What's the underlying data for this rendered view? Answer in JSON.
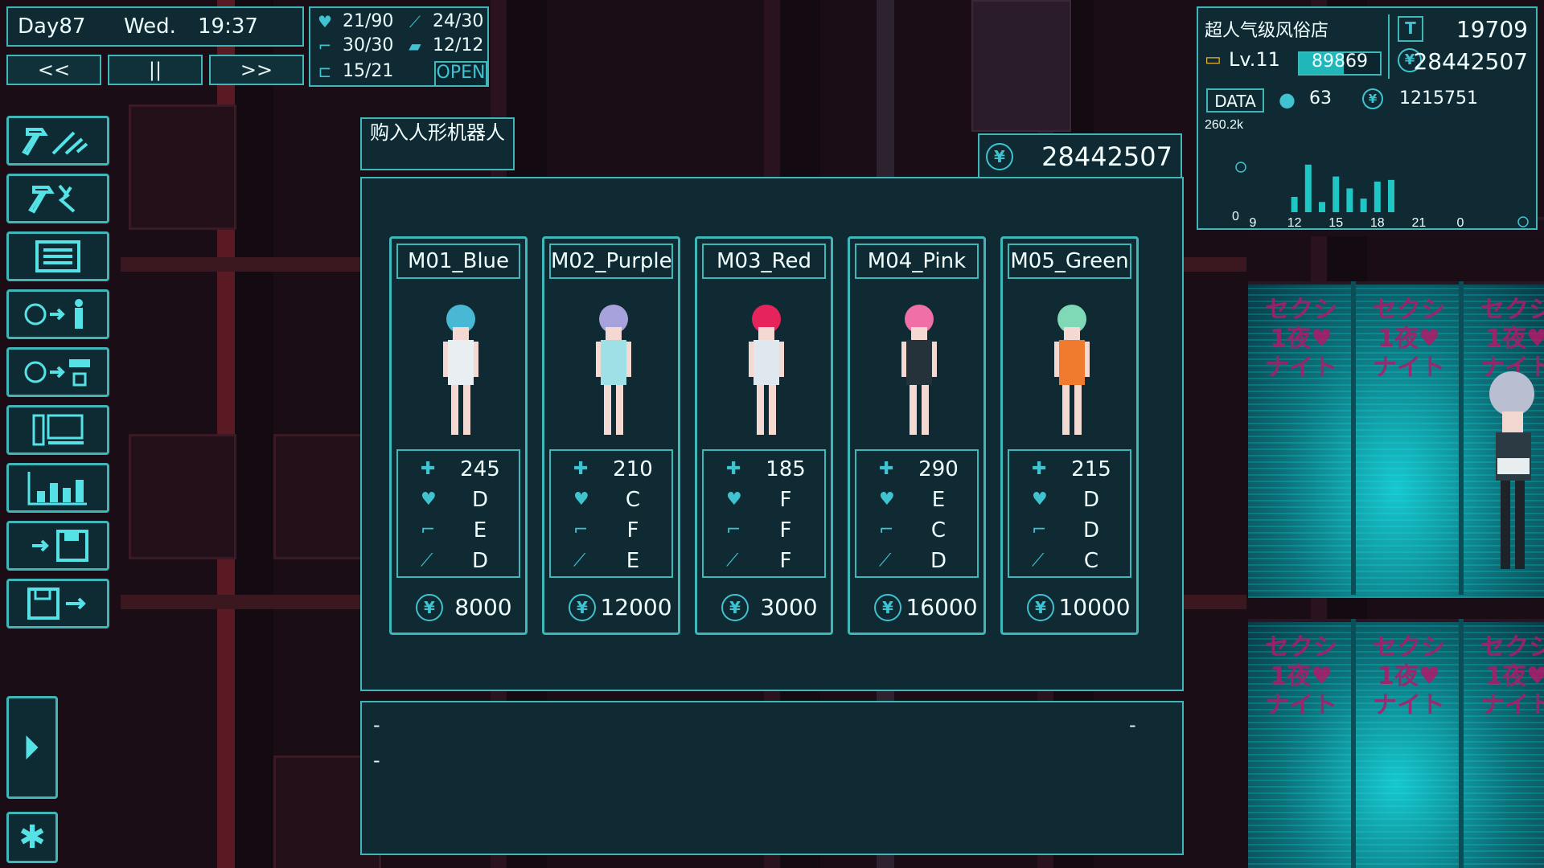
{
  "hud": {
    "day": "Day87",
    "weekday": "Wed.",
    "time": "19:37",
    "speed_buttons": [
      "<<",
      "||",
      ">>"
    ],
    "stats": [
      {
        "icon": "heart-icon",
        "value": "21/90"
      },
      {
        "icon": "wrench-icon",
        "value": "24/30"
      },
      {
        "icon": "gun-icon",
        "value": "30/30"
      },
      {
        "icon": "box-icon",
        "value": "12/12"
      },
      {
        "icon": "bed-icon",
        "value": "15/21"
      }
    ],
    "open_badge": "OPEN"
  },
  "toolbar": {
    "tools": [
      "build-tool",
      "repair-tool",
      "menu-list",
      "hire-staff",
      "buy-robot",
      "computer",
      "statistics",
      "save-game",
      "load-game"
    ],
    "play_button": "play-icon",
    "settings_button": "gear-icon"
  },
  "dialog": {
    "title": "购入人形机器人",
    "money": "28442507",
    "desc_lines": [
      "-",
      "-"
    ],
    "desc_right": "-"
  },
  "models": [
    {
      "name": "M01_Blue",
      "hp": "245",
      "love": "D",
      "gun": "E",
      "tool": "D",
      "price": "8000",
      "hair": "#49b8d4",
      "outfit": "#e8eef2"
    },
    {
      "name": "M02_Purple",
      "hp": "210",
      "love": "C",
      "gun": "F",
      "tool": "E",
      "price": "12000",
      "hair": "#a7a2dc",
      "outfit": "#9fe0e6"
    },
    {
      "name": "M03_Red",
      "hp": "185",
      "love": "F",
      "gun": "F",
      "tool": "F",
      "price": "3000",
      "hair": "#e6235a",
      "outfit": "#dfe8ee"
    },
    {
      "name": "M04_Pink",
      "hp": "290",
      "love": "E",
      "gun": "C",
      "tool": "D",
      "price": "16000",
      "hair": "#f06fa6",
      "outfit": "#26323a"
    },
    {
      "name": "M05_Green",
      "hp": "215",
      "love": "D",
      "gun": "D",
      "tool": "C",
      "price": "10000",
      "hair": "#7fd9b6",
      "outfit": "#f07a2e"
    }
  ],
  "info": {
    "shop_name": "超人气级风俗店",
    "tickets": "19709",
    "level": "Lv.11",
    "exp": "89869",
    "exp_fraction": 0.55,
    "money": "28442507",
    "data_label": "DATA",
    "customers": "63",
    "income": "1215751"
  },
  "chart_data": {
    "type": "bar",
    "ymax_label": "260.2k",
    "ymin_label": "0",
    "x_tick_labels": [
      "9",
      "12",
      "15",
      "18",
      "21",
      "0"
    ],
    "x_range": [
      9,
      24
    ],
    "values": [
      {
        "x": 12,
        "y": 45000
      },
      {
        "x": 13,
        "y": 140000
      },
      {
        "x": 14,
        "y": 30000
      },
      {
        "x": 15,
        "y": 105000
      },
      {
        "x": 16,
        "y": 70000
      },
      {
        "x": 17,
        "y": 40000
      },
      {
        "x": 18,
        "y": 90000
      },
      {
        "x": 19,
        "y": 95000
      }
    ],
    "ymax": 260200,
    "bar_color": "#1fc6c6"
  }
}
